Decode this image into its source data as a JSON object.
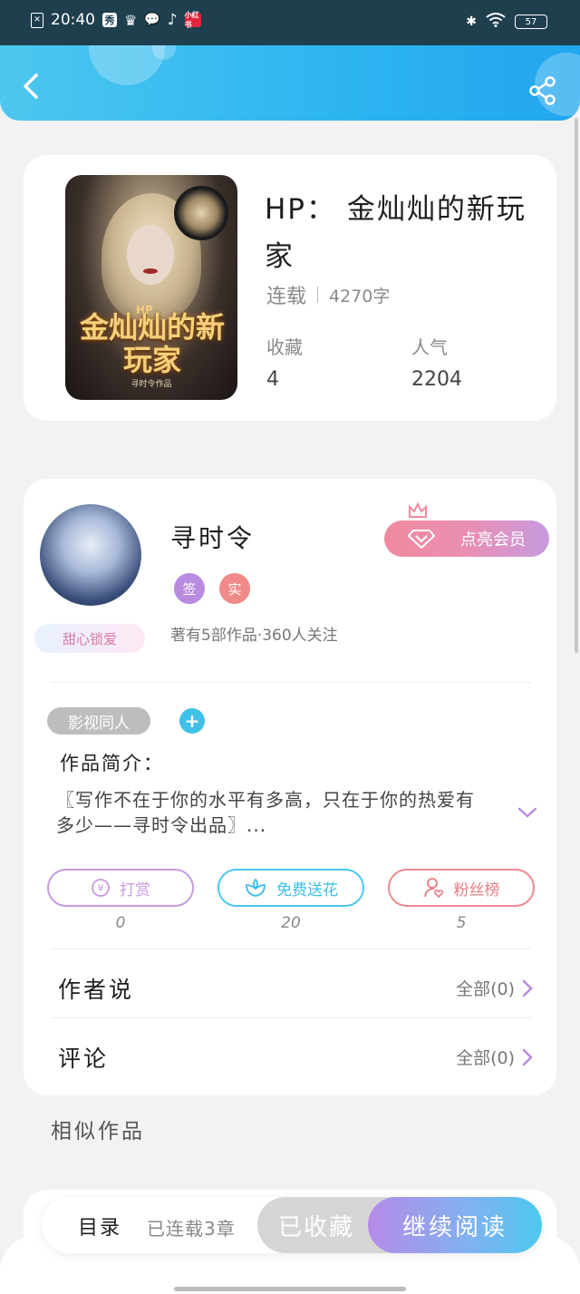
{
  "status_bar": {
    "time": "20:40",
    "app_badges": [
      "秀",
      "♛",
      "微",
      "♪",
      "小红书"
    ],
    "battery": "57"
  },
  "book": {
    "title": "HP： 金灿灿的新玩家",
    "status": "连载",
    "word_count": "4270字",
    "cover": {
      "tag": "HP",
      "title": "金灿灿的新玩家",
      "author": "寻时令作品"
    },
    "stats": [
      {
        "label": "收藏",
        "value": "4"
      },
      {
        "label": "人气",
        "value": "2204"
      }
    ]
  },
  "author": {
    "name": "寻时令",
    "badges": [
      "签",
      "实"
    ],
    "meta": "著有5部作品·360人关注",
    "avatar_tag": "甜心锁爱",
    "vip_button": "点亮会员"
  },
  "genre_tag": "影视同人",
  "add_tag": "+",
  "intro": {
    "label": "作品简介：",
    "text": "〖写作不在于你的水平有多高，只在于你的热爱有多少——寻时令出品〗..."
  },
  "actions": [
    {
      "label": "打赏",
      "count": "0",
      "color": "#c79ae0"
    },
    {
      "label": "免费送花",
      "count": "20",
      "color": "#4cc7ef"
    },
    {
      "label": "粉丝榜",
      "count": "5",
      "color": "#ec8b8f"
    }
  ],
  "rows": [
    {
      "label": "作者说",
      "more": "全部(0)"
    },
    {
      "label": "评论",
      "more": "全部(0)"
    }
  ],
  "similar_title": "相似作品",
  "bottom_bar": {
    "catalog": "目录",
    "chapters": "已连载3章",
    "collected": "已收藏",
    "continue_reading": "继续阅读"
  },
  "colors": {
    "header_blue": "#2db4f0",
    "accent_purple": "#c79ae0",
    "accent_cyan": "#4cc7ef",
    "accent_red": "#ec8b8f"
  }
}
